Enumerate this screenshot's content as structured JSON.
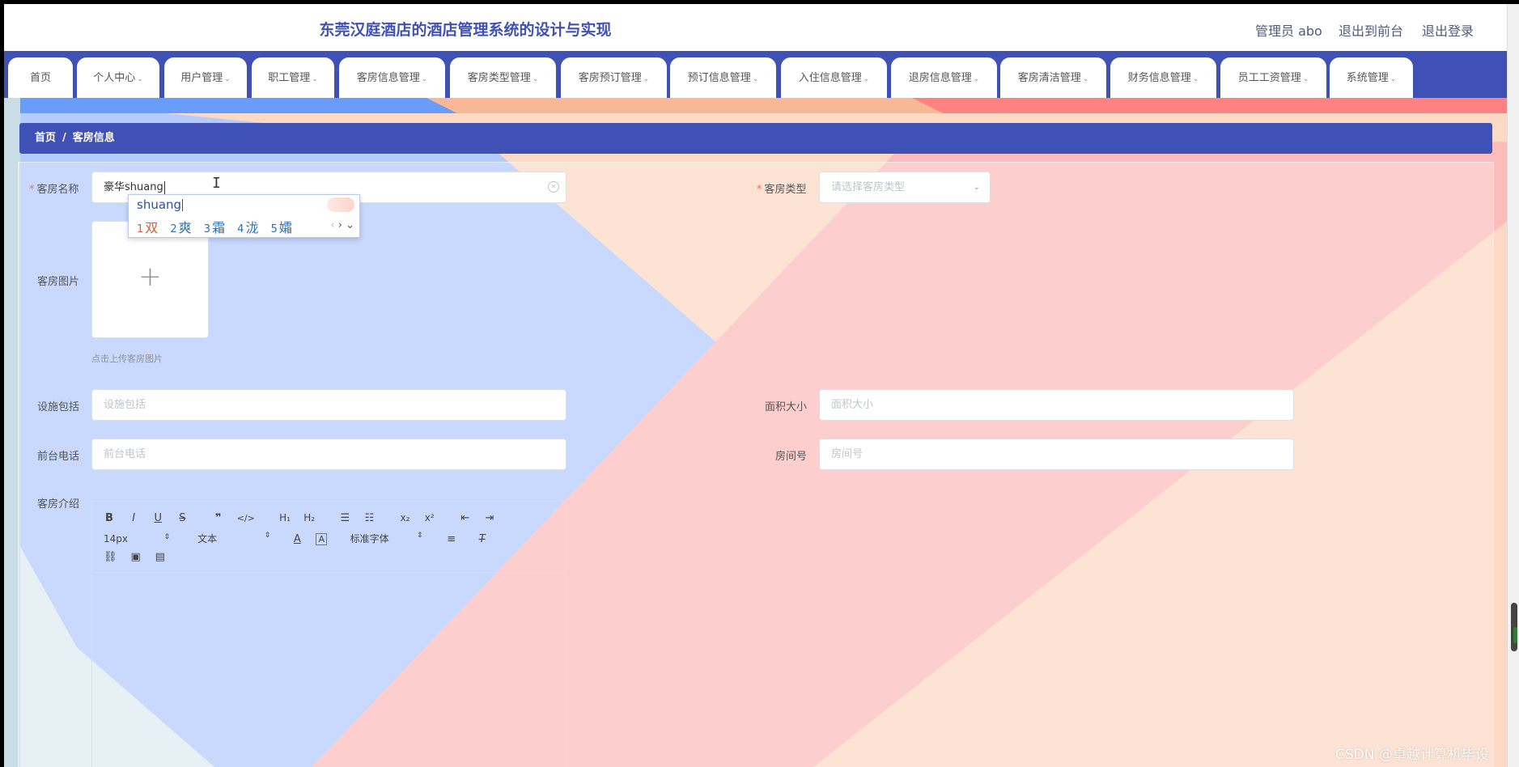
{
  "header": {
    "title": "东莞汉庭酒店的酒店管理系统的设计与实现",
    "admin_label": "管理员 abo",
    "front_label": "退出到前台",
    "logout_label": "退出登录"
  },
  "nav": {
    "items": [
      {
        "label": "首页"
      },
      {
        "label": "个人中心"
      },
      {
        "label": "用户管理"
      },
      {
        "label": "职工管理"
      },
      {
        "label": "客房信息管理"
      },
      {
        "label": "客房类型管理"
      },
      {
        "label": "客房预订管理"
      },
      {
        "label": "预订信息管理"
      },
      {
        "label": "入住信息管理"
      },
      {
        "label": "退房信息管理"
      },
      {
        "label": "客房清洁管理"
      },
      {
        "label": "财务信息管理"
      },
      {
        "label": "员工工资管理"
      },
      {
        "label": "系统管理"
      }
    ]
  },
  "breadcrumb": {
    "home": "首页",
    "separator": "/",
    "current": "客房信息"
  },
  "form": {
    "room_name": {
      "label": "客房名称",
      "value": "豪华shuang"
    },
    "room_type": {
      "label": "客房类型",
      "placeholder": "请选择客房类型"
    },
    "room_image": {
      "label": "客房图片",
      "tip": "点击上传客房图片"
    },
    "facilities": {
      "label": "设施包括",
      "placeholder": "设施包括"
    },
    "area": {
      "label": "面积大小",
      "placeholder": "面积大小"
    },
    "phone": {
      "label": "前台电话",
      "placeholder": "前台电话"
    },
    "room_number": {
      "label": "房间号",
      "placeholder": "房间号"
    },
    "intro": {
      "label": "客房介绍"
    }
  },
  "ime": {
    "composition": "shuang",
    "candidates": [
      {
        "num": "1",
        "text": "双"
      },
      {
        "num": "2",
        "text": "爽"
      },
      {
        "num": "3",
        "text": "霜"
      },
      {
        "num": "4",
        "text": "泷"
      },
      {
        "num": "5",
        "text": "孀"
      }
    ]
  },
  "editor": {
    "size_value": "14px",
    "header_value": "文本",
    "font_value": "标准字体"
  },
  "watermark": "CSDN @卓越计算机毕设",
  "colors": {
    "primary": "#3f51b5",
    "bg_blue": "#b3cbfd",
    "bg_pink": "#fdbcbc",
    "bg_peach": "#fcd9c4",
    "required": "#f56c6c"
  }
}
